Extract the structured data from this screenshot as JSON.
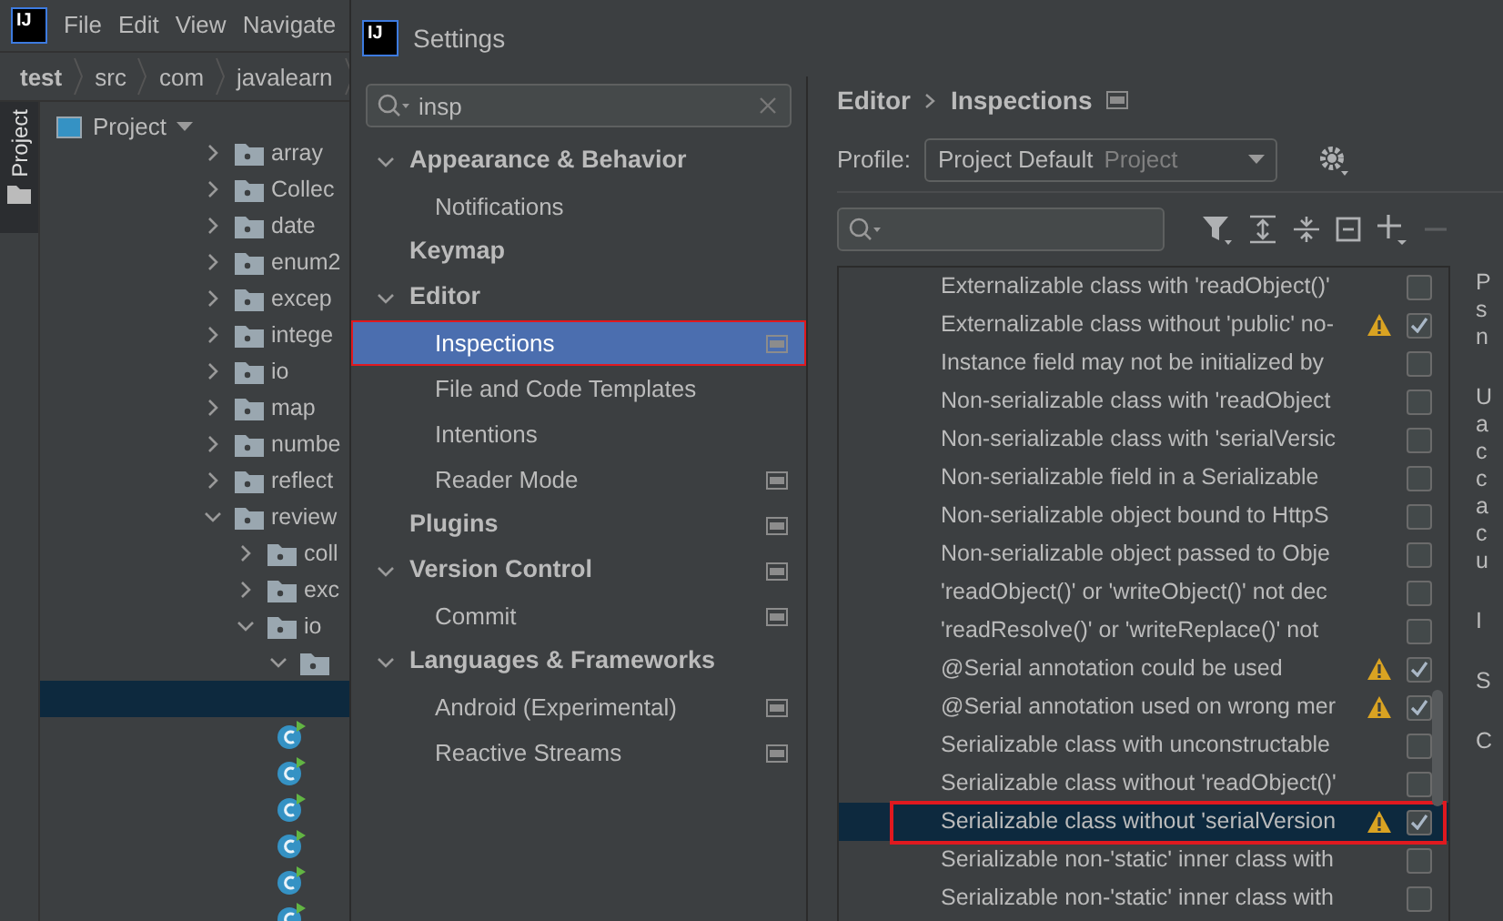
{
  "ide": {
    "logo_text": "IJ",
    "menu": [
      "File",
      "Edit",
      "View",
      "Navigate"
    ],
    "breadcrumb": [
      "test",
      "src",
      "com",
      "javalearn"
    ],
    "tool_strip": {
      "label": "Project"
    },
    "project_panel": {
      "title": "Project",
      "tree": [
        {
          "kind": "folder",
          "label": "array",
          "expanded": false
        },
        {
          "kind": "folder",
          "label": "Collec",
          "expanded": false
        },
        {
          "kind": "folder",
          "label": "date",
          "expanded": false
        },
        {
          "kind": "folder",
          "label": "enum2",
          "expanded": false
        },
        {
          "kind": "folder",
          "label": "excep",
          "expanded": false
        },
        {
          "kind": "folder",
          "label": "intege",
          "expanded": false
        },
        {
          "kind": "folder",
          "label": "io",
          "expanded": false
        },
        {
          "kind": "folder",
          "label": "map",
          "expanded": false
        },
        {
          "kind": "folder",
          "label": "numbe",
          "expanded": false
        },
        {
          "kind": "folder",
          "label": "reflect",
          "expanded": false
        },
        {
          "kind": "folder",
          "label": "review",
          "expanded": true,
          "children": [
            {
              "kind": "folder",
              "label": "coll",
              "expanded": false
            },
            {
              "kind": "folder",
              "label": "exc",
              "expanded": false
            },
            {
              "kind": "folder",
              "label": "io",
              "expanded": true,
              "children": [
                {
                  "kind": "folder",
                  "expanded": true,
                  "children": [
                    {
                      "kind": "blank",
                      "selected": true
                    },
                    {
                      "kind": "class",
                      "selected": false
                    },
                    {
                      "kind": "class",
                      "selected": false
                    },
                    {
                      "kind": "class",
                      "selected": false
                    },
                    {
                      "kind": "class",
                      "selected": false
                    },
                    {
                      "kind": "class",
                      "selected": false
                    },
                    {
                      "kind": "class",
                      "selected": false
                    }
                  ]
                }
              ]
            }
          ]
        }
      ]
    }
  },
  "dialog": {
    "logo_text": "IJ",
    "title": "Settings",
    "search": {
      "value": "insp"
    },
    "nav": [
      {
        "label": "Appearance & Behavior",
        "expanded": true,
        "children": [
          {
            "label": "Notifications",
            "selected": false,
            "project_level": false
          }
        ]
      },
      {
        "label": "Keymap"
      },
      {
        "label": "Editor",
        "expanded": true,
        "children": [
          {
            "label": "Inspections",
            "selected": true,
            "project_level": true,
            "highlighted": true
          },
          {
            "label": "File and Code Templates",
            "selected": false,
            "project_level": false
          },
          {
            "label": "Intentions",
            "selected": false,
            "project_level": false
          },
          {
            "label": "Reader Mode",
            "selected": false,
            "project_level": true
          }
        ]
      },
      {
        "label": "Plugins",
        "project_level": true
      },
      {
        "label": "Version Control",
        "expanded": true,
        "project_level": true,
        "children": [
          {
            "label": "Commit",
            "selected": false,
            "project_level": true
          }
        ]
      },
      {
        "label": "Languages & Frameworks",
        "expanded": true,
        "children": [
          {
            "label": "Android (Experimental)",
            "selected": false,
            "project_level": true
          },
          {
            "label": "Reactive Streams",
            "selected": false,
            "project_level": true
          }
        ]
      }
    ],
    "breadcrumb": [
      "Editor",
      "Inspections"
    ],
    "profile": {
      "label": "Profile:",
      "value": "Project Default",
      "scope": "Project"
    },
    "inspections": [
      {
        "label": "Externalizable class with 'readObject()'",
        "warning": false,
        "checked": false,
        "selected": false
      },
      {
        "label": "Externalizable class without 'public' no-",
        "warning": true,
        "checked": true,
        "selected": false
      },
      {
        "label": "Instance field may not be initialized by",
        "warning": false,
        "checked": false,
        "selected": false
      },
      {
        "label": "Non-serializable class with 'readObject",
        "warning": false,
        "checked": false,
        "selected": false
      },
      {
        "label": "Non-serializable class with 'serialVersic",
        "warning": false,
        "checked": false,
        "selected": false
      },
      {
        "label": "Non-serializable field in a Serializable",
        "warning": false,
        "checked": false,
        "selected": false
      },
      {
        "label": "Non-serializable object bound to HttpS",
        "warning": false,
        "checked": false,
        "selected": false
      },
      {
        "label": "Non-serializable object passed to Obje",
        "warning": false,
        "checked": false,
        "selected": false
      },
      {
        "label": "'readObject()' or 'writeObject()' not dec",
        "warning": false,
        "checked": false,
        "selected": false
      },
      {
        "label": "'readResolve()' or 'writeReplace()' not",
        "warning": false,
        "checked": false,
        "selected": false
      },
      {
        "label": "@Serial annotation could be used",
        "warning": true,
        "checked": true,
        "selected": false
      },
      {
        "label": "@Serial annotation used on wrong mer",
        "warning": true,
        "checked": true,
        "selected": false
      },
      {
        "label": "Serializable class with unconstructable",
        "warning": false,
        "checked": false,
        "selected": false
      },
      {
        "label": "Serializable class without 'readObject()'",
        "warning": false,
        "checked": false,
        "selected": false
      },
      {
        "label": "Serializable class without 'serialVersion",
        "warning": true,
        "checked": true,
        "selected": true,
        "highlighted": true
      },
      {
        "label": "Serializable non-'static' inner class with",
        "warning": false,
        "checked": false,
        "selected": false
      },
      {
        "label": "Serializable non-'static' inner class with",
        "warning": false,
        "checked": false,
        "selected": false
      }
    ],
    "description_fragments": [
      [
        "P",
        "s",
        "n"
      ],
      [
        "U",
        "a",
        "c",
        "c",
        "a",
        "c",
        "u"
      ],
      [
        "I"
      ],
      [
        "S"
      ],
      [
        "C"
      ]
    ]
  }
}
